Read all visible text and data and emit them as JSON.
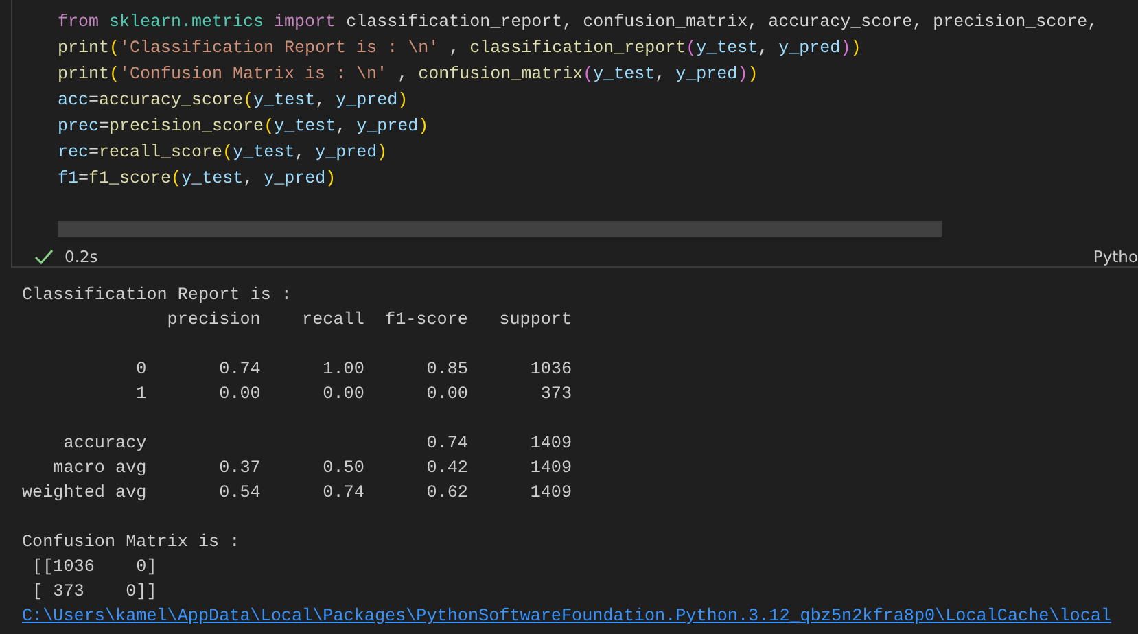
{
  "code_cell": {
    "lines": [
      [
        {
          "kind": "keyword",
          "text": "from "
        },
        {
          "kind": "module",
          "text": "sklearn.metrics"
        },
        {
          "kind": "keyword",
          "text": " import "
        },
        {
          "kind": "plain",
          "text": "classification_report, confusion_matrix, accuracy_score, precision_score,"
        }
      ],
      [
        {
          "kind": "function",
          "text": "print"
        },
        {
          "kind": "bracket",
          "text": "("
        },
        {
          "kind": "string",
          "text": "'Classification Report is : \\n'"
        },
        {
          "kind": "plain",
          "text": " , "
        },
        {
          "kind": "function",
          "text": "classification_report"
        },
        {
          "kind": "bracket2",
          "text": "("
        },
        {
          "kind": "variable",
          "text": "y_test"
        },
        {
          "kind": "plain",
          "text": ", "
        },
        {
          "kind": "variable",
          "text": "y_pred"
        },
        {
          "kind": "bracket2",
          "text": ")"
        },
        {
          "kind": "bracket",
          "text": ")"
        }
      ],
      [
        {
          "kind": "function",
          "text": "print"
        },
        {
          "kind": "bracket",
          "text": "("
        },
        {
          "kind": "string",
          "text": "'Confusion Matrix is : \\n'"
        },
        {
          "kind": "plain",
          "text": " , "
        },
        {
          "kind": "function",
          "text": "confusion_matrix"
        },
        {
          "kind": "bracket2",
          "text": "("
        },
        {
          "kind": "variable",
          "text": "y_test"
        },
        {
          "kind": "plain",
          "text": ", "
        },
        {
          "kind": "variable",
          "text": "y_pred"
        },
        {
          "kind": "bracket2",
          "text": ")"
        },
        {
          "kind": "bracket",
          "text": ")"
        }
      ],
      [
        {
          "kind": "variable",
          "text": "acc"
        },
        {
          "kind": "plain",
          "text": "="
        },
        {
          "kind": "function",
          "text": "accuracy_score"
        },
        {
          "kind": "bracket",
          "text": "("
        },
        {
          "kind": "variable",
          "text": "y_test"
        },
        {
          "kind": "plain",
          "text": ", "
        },
        {
          "kind": "variable",
          "text": "y_pred"
        },
        {
          "kind": "bracket",
          "text": ")"
        }
      ],
      [
        {
          "kind": "variable",
          "text": "prec"
        },
        {
          "kind": "plain",
          "text": "="
        },
        {
          "kind": "function",
          "text": "precision_score"
        },
        {
          "kind": "bracket",
          "text": "("
        },
        {
          "kind": "variable",
          "text": "y_test"
        },
        {
          "kind": "plain",
          "text": ", "
        },
        {
          "kind": "variable",
          "text": "y_pred"
        },
        {
          "kind": "bracket",
          "text": ")"
        }
      ],
      [
        {
          "kind": "variable",
          "text": "rec"
        },
        {
          "kind": "plain",
          "text": "="
        },
        {
          "kind": "function",
          "text": "recall_score"
        },
        {
          "kind": "bracket",
          "text": "("
        },
        {
          "kind": "variable",
          "text": "y_test"
        },
        {
          "kind": "plain",
          "text": ", "
        },
        {
          "kind": "variable",
          "text": "y_pred"
        },
        {
          "kind": "bracket",
          "text": ")"
        }
      ],
      [
        {
          "kind": "variable",
          "text": "f1"
        },
        {
          "kind": "plain",
          "text": "="
        },
        {
          "kind": "function",
          "text": "f1_score"
        },
        {
          "kind": "bracket",
          "text": "("
        },
        {
          "kind": "variable",
          "text": "y_test"
        },
        {
          "kind": "plain",
          "text": ", "
        },
        {
          "kind": "variable",
          "text": "y_pred"
        },
        {
          "kind": "bracket",
          "text": ")"
        }
      ]
    ],
    "status": {
      "succeeded": true,
      "duration": "0.2s",
      "kernel": "Pytho"
    }
  },
  "output": {
    "lines": [
      {
        "kind": "text",
        "text": "Classification Report is :"
      },
      {
        "kind": "text",
        "text": "              precision    recall  f1-score   support"
      },
      {
        "kind": "blank"
      },
      {
        "kind": "text",
        "text": "           0       0.74      1.00      0.85      1036"
      },
      {
        "kind": "text",
        "text": "           1       0.00      0.00      0.00       373"
      },
      {
        "kind": "blank"
      },
      {
        "kind": "text",
        "text": "    accuracy                           0.74      1409"
      },
      {
        "kind": "text",
        "text": "   macro avg       0.37      0.50      0.42      1409"
      },
      {
        "kind": "text",
        "text": "weighted avg       0.54      0.74      0.62      1409"
      },
      {
        "kind": "blank"
      },
      {
        "kind": "text",
        "text": "Confusion Matrix is :"
      },
      {
        "kind": "text",
        "text": " [[1036    0]"
      },
      {
        "kind": "text",
        "text": " [ 373    0]]"
      },
      {
        "kind": "path",
        "text": "C:\\Users\\kamel\\AppData\\Local\\Packages\\PythonSoftwareFoundation.Python.3.12_qbz5n2kfra8p0\\LocalCache\\local"
      }
    ]
  }
}
